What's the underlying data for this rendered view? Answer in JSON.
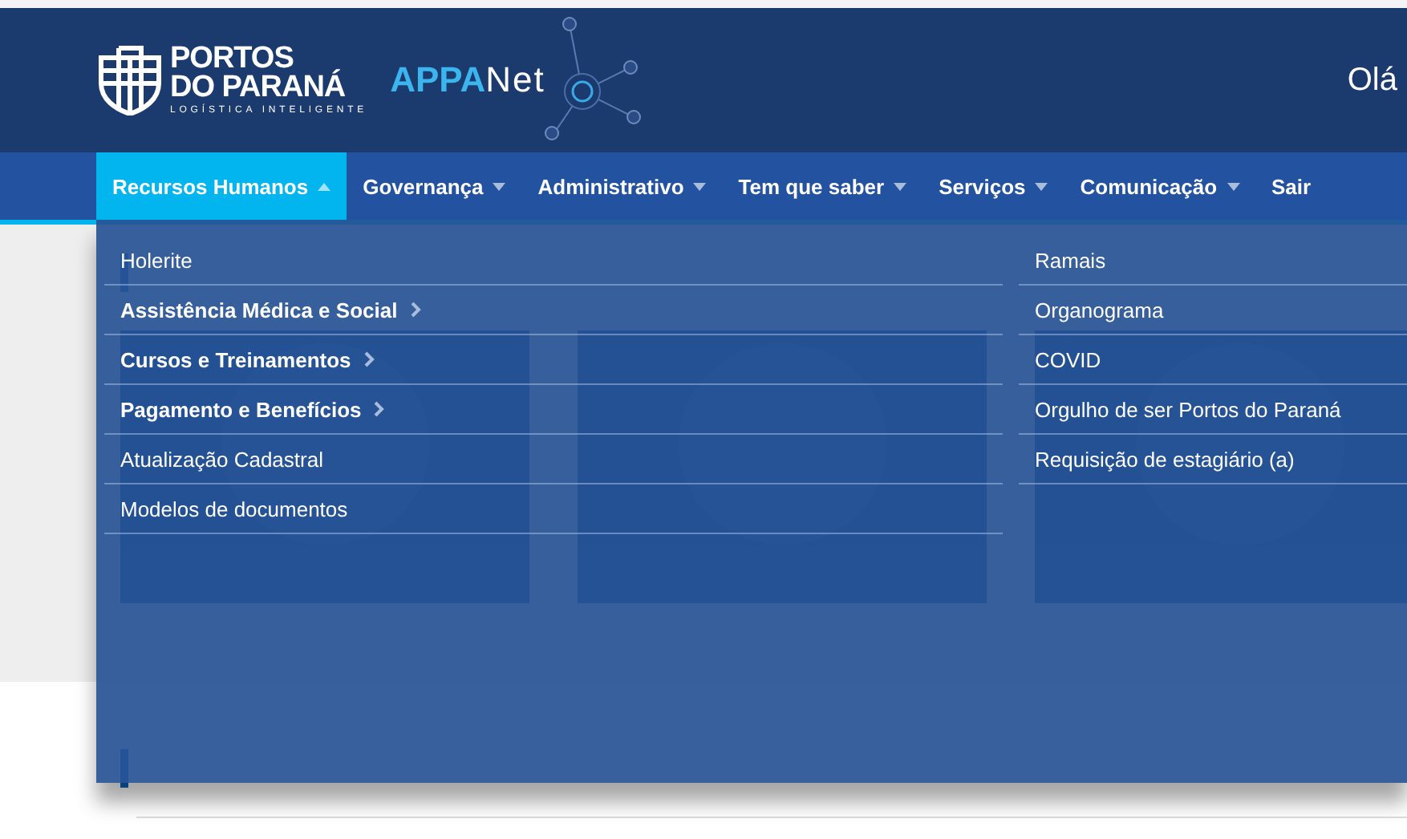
{
  "header": {
    "logo": {
      "line_1": "PORTOS",
      "line_2": "DO PARANÁ",
      "tagline": "LOGÍSTICA INTELIGENTE"
    },
    "app_name": {
      "part_1": "APPA",
      "part_2": "Net"
    },
    "greeting": "Olá"
  },
  "nav": [
    {
      "label": "Recursos Humanos",
      "kind": "menu",
      "selected": true
    },
    {
      "label": "Governança",
      "kind": "menu",
      "selected": false
    },
    {
      "label": "Administrativo",
      "kind": "menu",
      "selected": false
    },
    {
      "label": "Tem que saber",
      "kind": "menu",
      "selected": false
    },
    {
      "label": "Serviços",
      "kind": "menu",
      "selected": false
    },
    {
      "label": "Comunicação",
      "kind": "menu",
      "selected": false
    },
    {
      "label": "Sair",
      "kind": "link",
      "selected": false
    }
  ],
  "dropdown": {
    "columns": [
      [
        {
          "label": "Holerite",
          "kind": "link"
        },
        {
          "label": "Assistência Médica e Social",
          "kind": "submenu"
        },
        {
          "label": "Cursos e Treinamentos",
          "kind": "submenu"
        },
        {
          "label": "Pagamento e Benefícios",
          "kind": "submenu"
        },
        {
          "label": "Atualização Cadastral",
          "kind": "link"
        },
        {
          "label": "Modelos de documentos",
          "kind": "link"
        }
      ],
      [
        {
          "label": "Ramais",
          "kind": "link"
        },
        {
          "label": "Organograma",
          "kind": "link"
        },
        {
          "label": "COVID",
          "kind": "link"
        },
        {
          "label": "Orgulho de ser Portos do Paraná",
          "kind": "link"
        },
        {
          "label": "Requisição de estagiário (a)",
          "kind": "link"
        }
      ]
    ]
  }
}
